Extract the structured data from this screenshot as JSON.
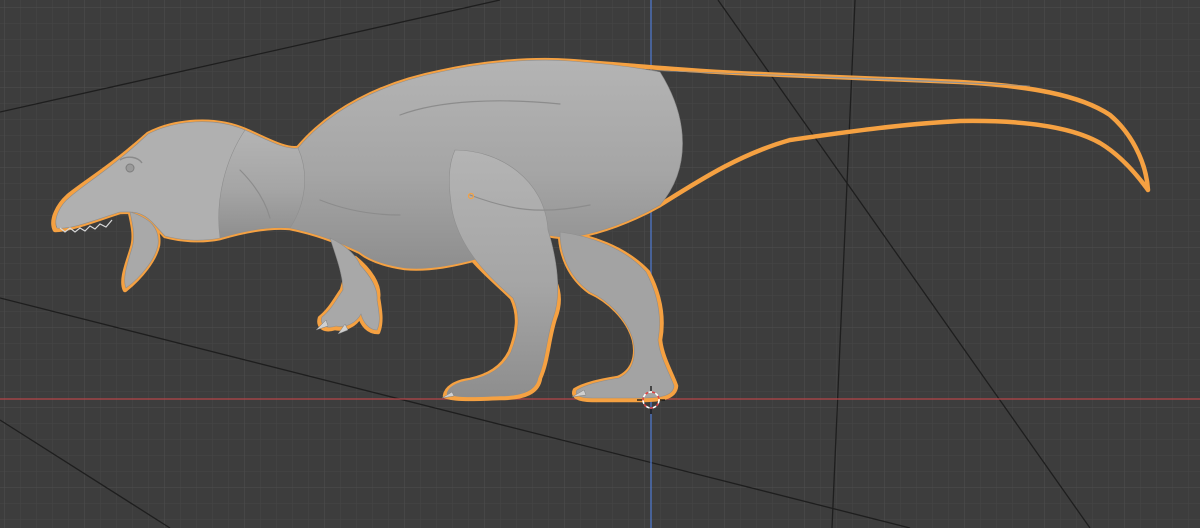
{
  "viewport": {
    "background_color": "#3d3d3d",
    "grid_minor_color": "#474747",
    "grid_major_color": "#505050",
    "x_axis_color": "#b5454a",
    "y_axis_color": "#4e77c9",
    "selection_outline_color": "#f5a142",
    "mesh_color": "#a8a8a8",
    "mesh_shadow_color": "#8a8a8a"
  },
  "object": {
    "name": "dinosaur-mesh",
    "selected": true
  },
  "cursor": {
    "icon": "3d-cursor-icon"
  }
}
